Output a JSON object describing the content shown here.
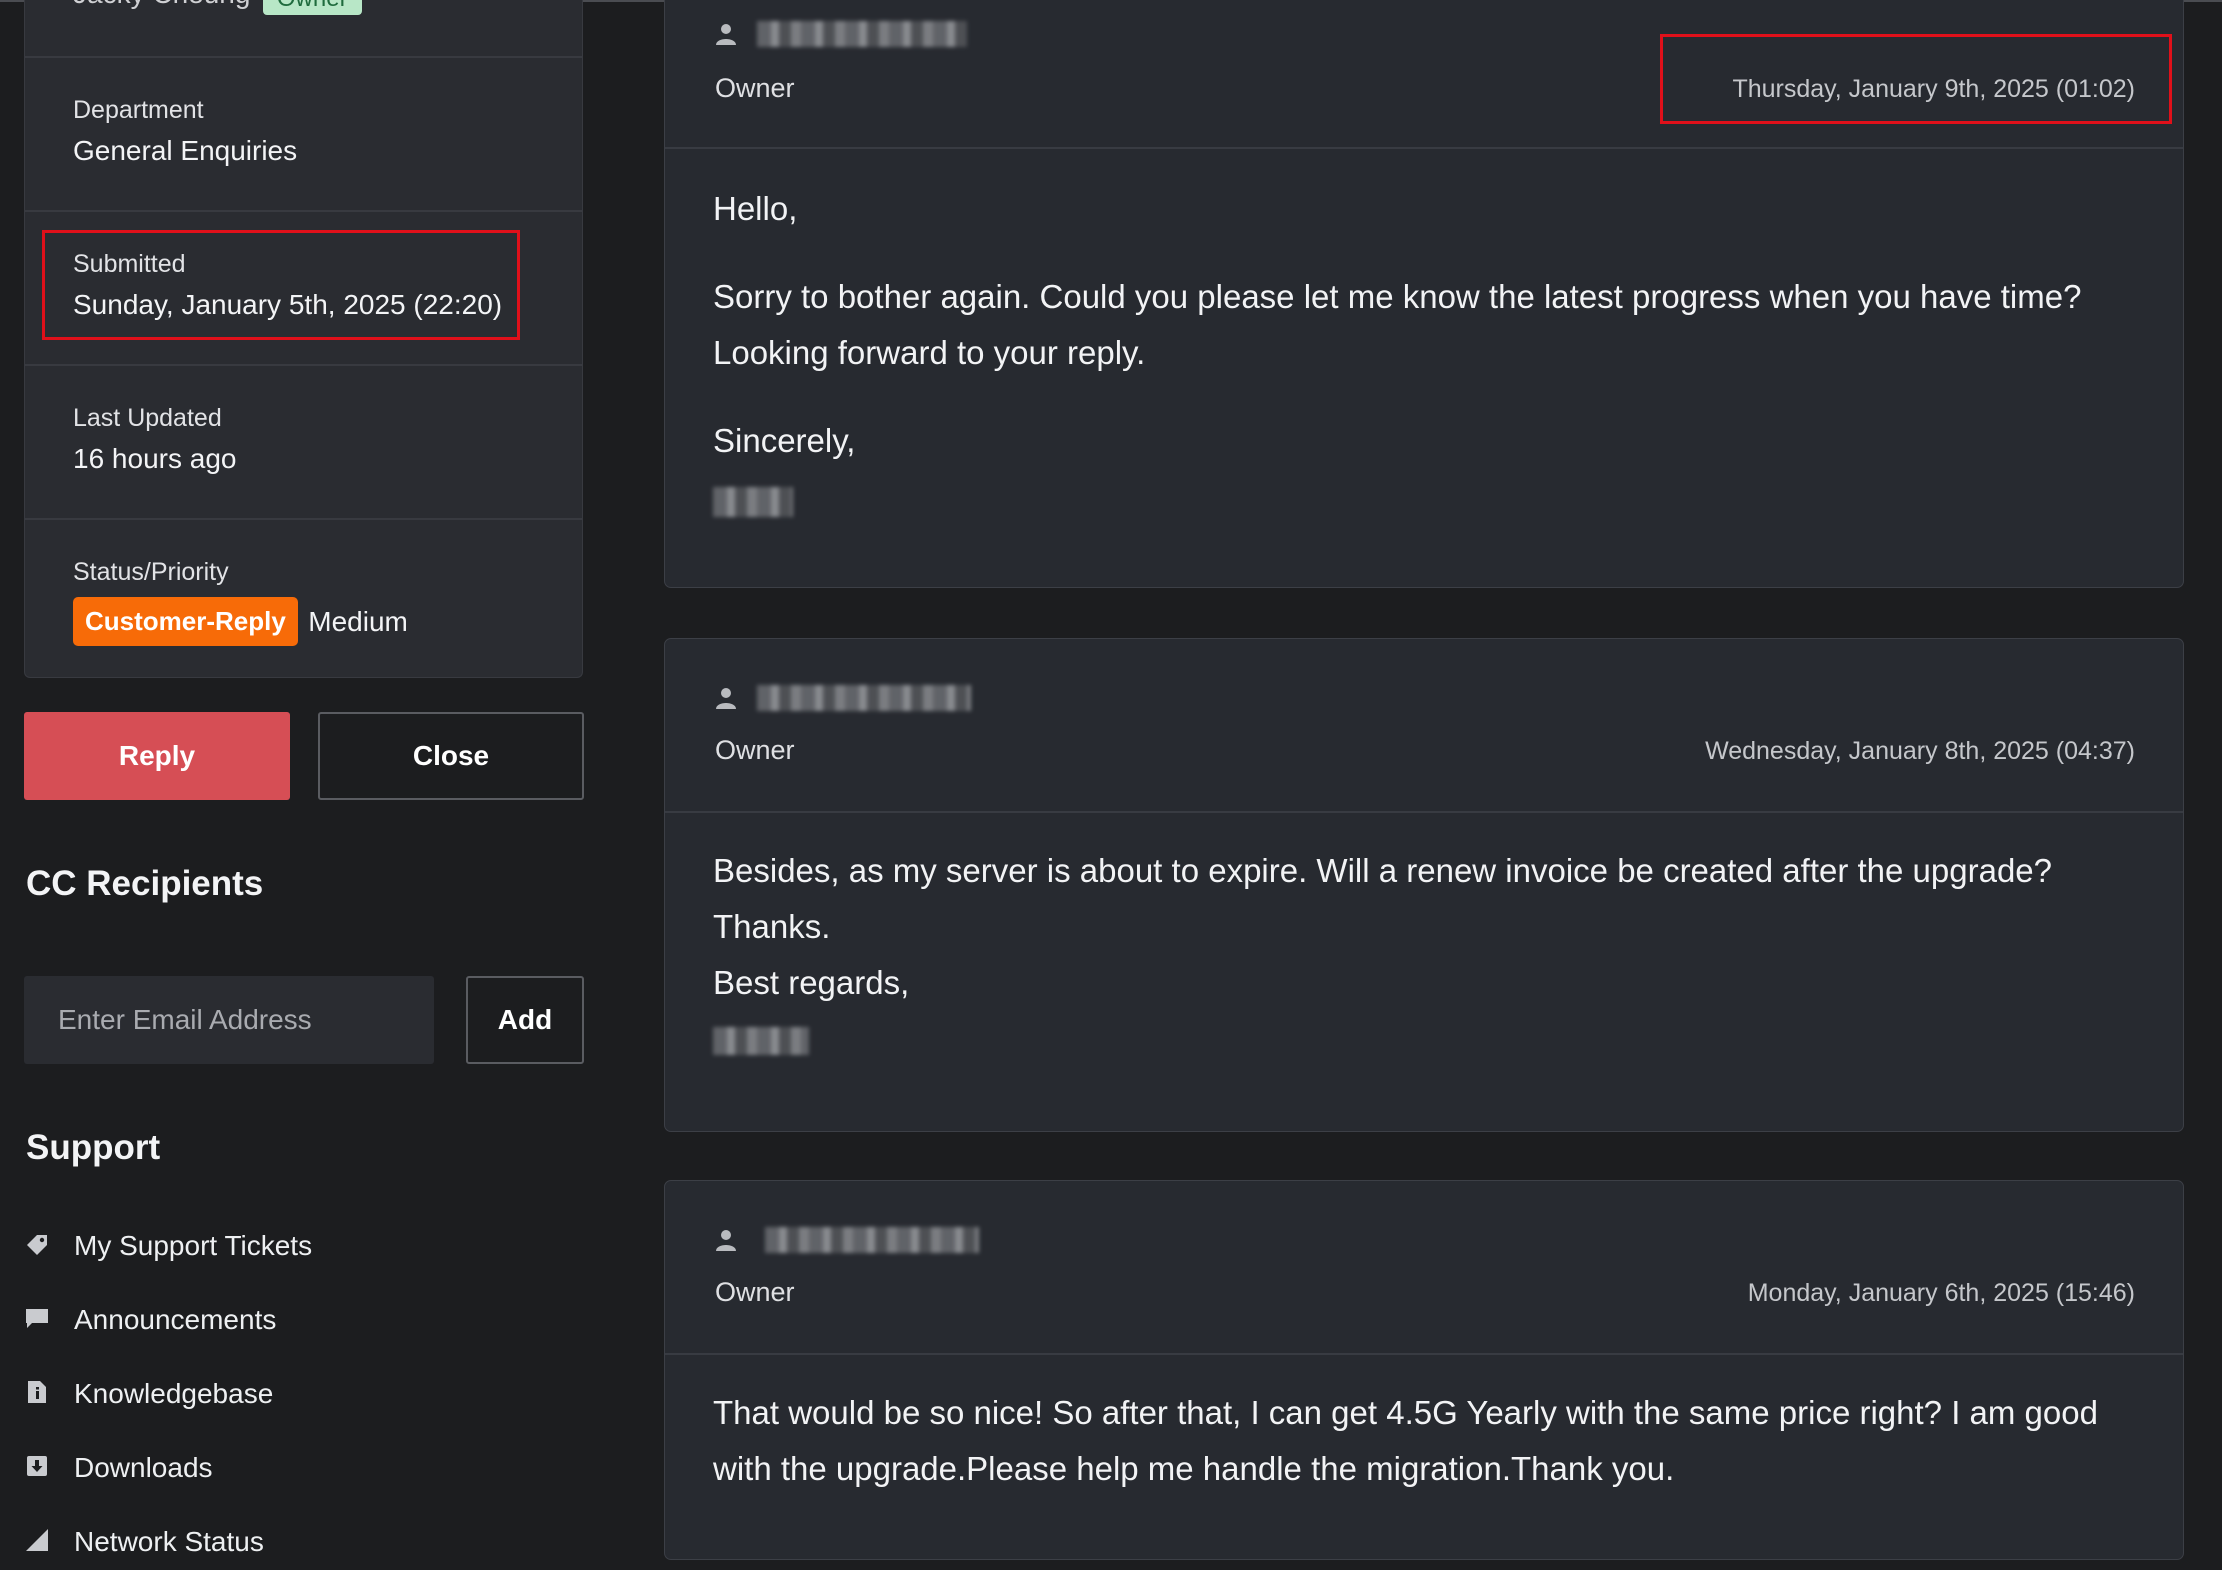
{
  "ticket_info": {
    "top_name": "Jacky Cheung",
    "top_badge": "Owner",
    "department_label": "Department",
    "department_value": "General Enquiries",
    "submitted_label": "Submitted",
    "submitted_value": "Sunday, January 5th, 2025 (22:20)",
    "last_updated_label": "Last Updated",
    "last_updated_value": "16 hours ago",
    "status_label": "Status/Priority",
    "status_value": "Customer-Reply",
    "priority_value": "Medium"
  },
  "actions": {
    "reply_label": "Reply",
    "close_label": "Close"
  },
  "cc": {
    "title": "CC Recipients",
    "email_placeholder": "Enter Email Address",
    "add_label": "Add"
  },
  "support": {
    "title": "Support",
    "items": [
      {
        "label": "My Support Tickets",
        "icon": "tag-icon"
      },
      {
        "label": "Announcements",
        "icon": "comment-icon"
      },
      {
        "label": "Knowledgebase",
        "icon": "info-document-icon"
      },
      {
        "label": "Downloads",
        "icon": "download-icon"
      },
      {
        "label": "Network Status",
        "icon": "signal-icon"
      }
    ]
  },
  "messages": [
    {
      "role": "Owner",
      "date": "Thursday, January 9th, 2025 (01:02)",
      "lines": [
        "Hello,",
        "Sorry to bother again. Could you please let me know the latest progress when you have time?",
        "Looking forward to your reply.",
        "Sincerely,"
      ]
    },
    {
      "role": "Owner",
      "date": "Wednesday, January 8th, 2025 (04:37)",
      "lines": [
        "Besides, as my server is about to expire. Will a renew invoice be created after the upgrade?",
        "Thanks.",
        "Best regards,"
      ]
    },
    {
      "role": "Owner",
      "date": "Monday, January 6th, 2025 (15:46)",
      "lines": [
        "That would be so nice! So after that, I can get 4.5G Yearly with the same price right? I am good",
        "with the upgrade.Please help me handle the migration.Thank you."
      ]
    }
  ],
  "colors": {
    "background": "#1c1d1f",
    "card": "#2a2c31",
    "reply_button": "#d64e55",
    "status_badge": "#f76b08",
    "highlight_box": "#e0101a"
  }
}
